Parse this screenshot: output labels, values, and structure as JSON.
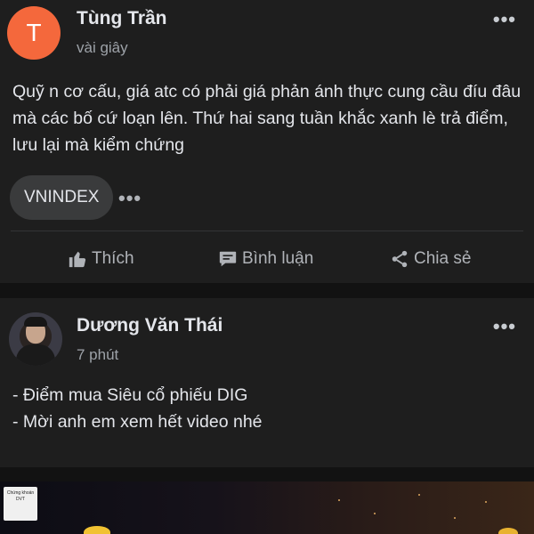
{
  "posts": [
    {
      "author": "Tùng Trần",
      "avatar_letter": "T",
      "time": "vài giây",
      "content": "Quỹ n cơ cấu, giá atc có phải giá phản ánh thực cung cầu đíu đâu mà các bố cứ loạn lên. Thứ hai sang tuần khắc xanh lè trả điểm, lưu lại mà kiểm chứng",
      "tag": "VNINDEX",
      "more_icon": "more-dots-icon",
      "actions": {
        "like": "Thích",
        "comment": "Bình luận",
        "share": "Chia sẻ"
      }
    },
    {
      "author": "Dương Văn Thái",
      "time": "7 phút",
      "content_lines": [
        "- Điểm mua Siêu cổ phiếu DIG",
        "- Mời anh em xem hết video nhé"
      ],
      "more_icon": "more-dots-icon"
    }
  ],
  "video": {
    "logo_text": "Chứng khoán DVT"
  },
  "icons": {
    "like": "thumbs-up-icon",
    "comment": "comment-bubble-icon",
    "share": "share-icon"
  },
  "colors": {
    "background": "#121212",
    "card": "#1e1e1e",
    "avatar_accent": "#f4683c",
    "text_primary": "#e4e6eb",
    "text_secondary": "#9da2a8"
  }
}
